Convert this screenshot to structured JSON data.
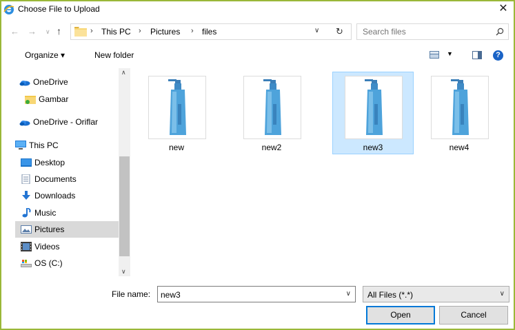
{
  "window": {
    "title": "Choose File to Upload",
    "close_glyph": "✕",
    "border_color": "#9ab838"
  },
  "address": {
    "breadcrumb": [
      "This PC",
      "Pictures",
      "files"
    ],
    "separator": "›"
  },
  "search": {
    "placeholder": "Search files"
  },
  "toolbar": {
    "organize_label": "Organize ▾",
    "new_folder_label": "New folder",
    "help_label": "?"
  },
  "nav_pane": {
    "items": [
      {
        "label": "OneDrive",
        "icon": "onedrive-icon"
      },
      {
        "label": "Gambar",
        "icon": "folder-icon"
      },
      {
        "label": "OneDrive - Oriflar",
        "icon": "onedrive-icon"
      },
      {
        "label": "This PC",
        "icon": "computer-icon"
      },
      {
        "label": "Desktop",
        "icon": "desktop-icon"
      },
      {
        "label": "Documents",
        "icon": "documents-icon"
      },
      {
        "label": "Downloads",
        "icon": "downloads-icon"
      },
      {
        "label": "Music",
        "icon": "music-icon"
      },
      {
        "label": "Pictures",
        "icon": "pictures-icon",
        "selected": true
      },
      {
        "label": "Videos",
        "icon": "videos-icon"
      },
      {
        "label": "OS (C:)",
        "icon": "drive-icon"
      }
    ]
  },
  "files": [
    {
      "name": "new",
      "selected": false
    },
    {
      "name": "new2",
      "selected": false
    },
    {
      "name": "new3",
      "selected": true
    },
    {
      "name": "new4",
      "selected": false
    }
  ],
  "bottom": {
    "file_name_label": "File name:",
    "file_name_value": "new3",
    "file_type_value": "All Files (*.*)",
    "open_label": "Open",
    "cancel_label": "Cancel"
  },
  "colors": {
    "selection_bg": "#cce8ff",
    "selection_border": "#99d1ff",
    "accent": "#0078d7"
  }
}
